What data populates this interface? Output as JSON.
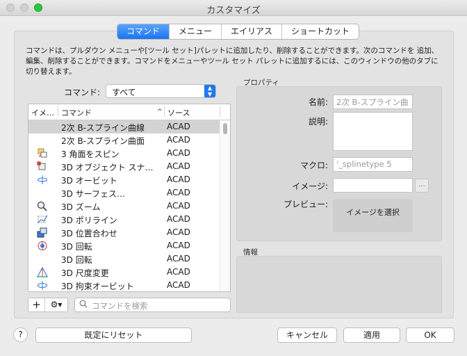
{
  "window": {
    "title": "カスタマイズ"
  },
  "tabs": [
    {
      "label": "コマンド"
    },
    {
      "label": "メニュー"
    },
    {
      "label": "エイリアス"
    },
    {
      "label": "ショートカット"
    }
  ],
  "description": "コマンドは、プルダウン メニューや[ツール セット]パレットに追加したり、削除することができます。次のコマンドを 追加、編集、削除することができます。コマンドをメニューやツール セット パレットに追加するには、このウィンドウの他のタブに切り替えます。",
  "command_filter": {
    "label": "コマンド:",
    "value": "すべて"
  },
  "table": {
    "columns": [
      "イメ…",
      "コマンド",
      "ソース"
    ],
    "sort_indicator": "^",
    "rows": [
      {
        "icon": "",
        "name": "2次 B-スプライン曲線",
        "source": "ACAD",
        "selected": true
      },
      {
        "icon": "",
        "name": "2次 B-スプライン曲面",
        "source": "ACAD"
      },
      {
        "icon": "spin-faces-icon",
        "name": "3 角面をスピン",
        "source": "ACAD"
      },
      {
        "icon": "object-snap-icon",
        "name": "3D オブジェクト スナッ…",
        "source": "ACAD"
      },
      {
        "icon": "orbit-icon",
        "name": "3D オービット",
        "source": "ACAD"
      },
      {
        "icon": "",
        "name": "3D サーフェス…",
        "source": "ACAD"
      },
      {
        "icon": "zoom-icon",
        "name": "3D ズーム",
        "source": "ACAD"
      },
      {
        "icon": "polyline-icon",
        "name": "3D ポリライン",
        "source": "ACAD"
      },
      {
        "icon": "align-icon",
        "name": "3D 位置合わせ",
        "source": "ACAD"
      },
      {
        "icon": "rotate-icon",
        "name": "3D 回転",
        "source": "ACAD"
      },
      {
        "icon": "",
        "name": "3D 回転",
        "source": "ACAD"
      },
      {
        "icon": "scale-icon",
        "name": "3D 尺度変更",
        "source": "ACAD"
      },
      {
        "icon": "constrained-orbit-icon",
        "name": "3D 拘束オービット",
        "source": "ACAD"
      }
    ]
  },
  "list_buttons": {
    "add": "+",
    "gear": "⚙▾"
  },
  "search": {
    "placeholder": "コマンドを検索",
    "value": ""
  },
  "properties": {
    "title": "プロパティ",
    "name_label": "名前:",
    "name_value": "2次 B-スプライン曲",
    "description_label": "説明:",
    "macro_label": "マクロ:",
    "macro_value": "'_splinetype 5",
    "image_label": "イメージ:",
    "browse_label": "...",
    "preview_label": "プレビュー:",
    "select_image_label": "イメージを選択"
  },
  "info": {
    "title": "情報"
  },
  "footer": {
    "help": "?",
    "reset": "既定にリセット",
    "cancel": "キャンセル",
    "apply": "適用",
    "ok": "OK"
  },
  "colors": {
    "accent": "#1a74f0",
    "zoom_button": "#2bc840"
  }
}
